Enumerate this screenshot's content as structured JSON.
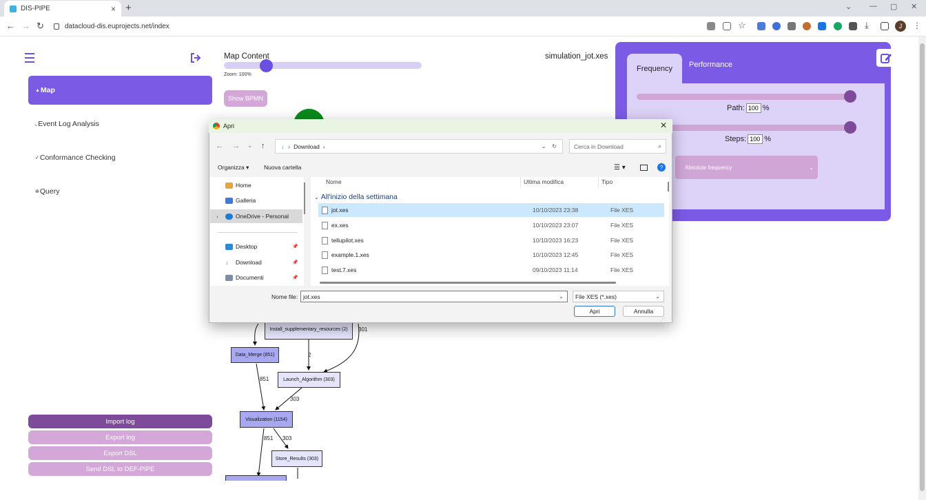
{
  "browser": {
    "tab_title": "DIS-PIPE",
    "url": "datacloud-dis.euprojects.net/index",
    "profile_initial": "J"
  },
  "sidebar": {
    "items": [
      {
        "label": "Map",
        "active": true
      },
      {
        "label": "Event Log Analysis"
      },
      {
        "label": "Conformance Checking"
      },
      {
        "label": "Query"
      }
    ],
    "buttons": [
      "Import log",
      "Export log",
      "Export DSL",
      "Send DSL to DEF-PIPE"
    ]
  },
  "map": {
    "title": "Map Content",
    "zoom_label": "Zoom: 100%",
    "zoom_fraction": 0.2,
    "bpmn_button": "Show BPMN",
    "file_title": "simulation_jot.xes"
  },
  "right_panel": {
    "tabs": [
      "Frequency",
      "Performance"
    ],
    "path_label": "Path:",
    "path_value": "100",
    "steps_label": "Steps:",
    "steps_value": "100",
    "percent": "%",
    "frequency_select": "Absolute frequency"
  },
  "graph": {
    "nodes": {
      "install": "Install_supplementary_resources (2)",
      "data_merge": "Data_Merge (851)",
      "launch": "Launch_Algorithm (303)",
      "visualization": "Visualization (1154)",
      "store": "Store_Results (303)"
    },
    "edge_labels": [
      "301",
      "2",
      "851",
      "303",
      "851",
      "303"
    ]
  },
  "dialog": {
    "title": "Apri",
    "path": [
      "Download"
    ],
    "search_placeholder": "Cerca in Download",
    "organize": "Organizza",
    "new_folder": "Nuova cartella",
    "nav": [
      {
        "label": "Home"
      },
      {
        "label": "Galleria"
      },
      {
        "label": "OneDrive - Personal",
        "selected": true
      },
      {
        "label": "Desktop"
      },
      {
        "label": "Download"
      },
      {
        "label": "Documenti"
      }
    ],
    "columns": [
      "Nome",
      "Ultima modifica",
      "Tipo"
    ],
    "group_label": "All'inizio della settimana",
    "files": [
      {
        "name": "jot.xes",
        "date": "10/10/2023 23:38",
        "type": "File XES",
        "selected": true
      },
      {
        "name": "ex.xes",
        "date": "10/10/2023 23:07",
        "type": "File XES"
      },
      {
        "name": "tellupilot.xes",
        "date": "10/10/2023 16:23",
        "type": "File XES"
      },
      {
        "name": "example.1.xes",
        "date": "10/10/2023 12:45",
        "type": "File XES"
      },
      {
        "name": "test.7.xes",
        "date": "09/10/2023 11:14",
        "type": "File XES"
      }
    ],
    "filename_label": "Nome file:",
    "filename_value": "jot.xes",
    "filetype": "File XES (*.xes)",
    "open_button": "Apri",
    "cancel_button": "Annulla"
  },
  "colors": {
    "primary": "#7b5be6",
    "accent_dark": "#7d4b9a",
    "accent_light": "#d3a7d8"
  }
}
